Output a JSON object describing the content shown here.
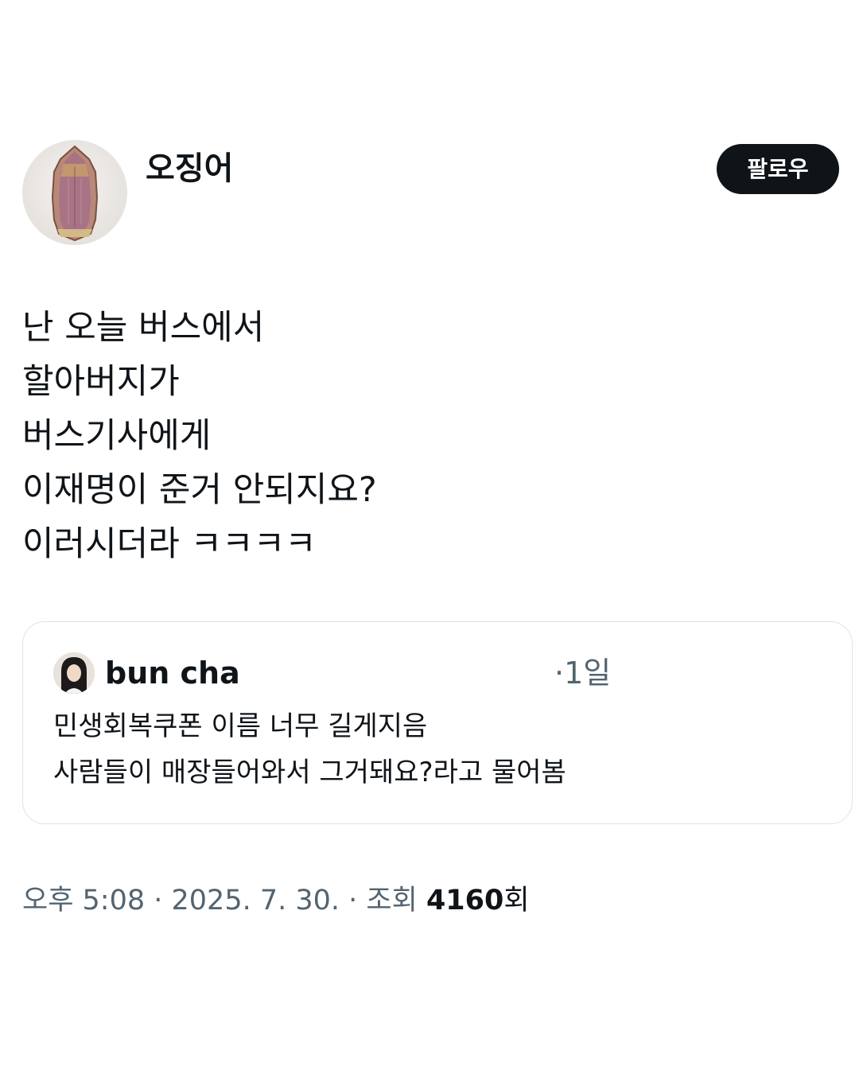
{
  "author": {
    "name": "오징어",
    "handle": ""
  },
  "follow_label": "팔로우",
  "post": {
    "lines": [
      "난 오늘 버스에서",
      "할아버지가",
      "버스기사에게",
      "이재명이 준거 안되지요?",
      "이러시더라 ㅋㅋㅋㅋ"
    ]
  },
  "quote": {
    "name": "bun cha",
    "time": "·1일",
    "lines": [
      "민생회복쿠폰 이름 너무 길게지음",
      "사람들이 매장들어와서 그거돼요?라고 물어봄"
    ]
  },
  "meta": {
    "time": "오후 5:08",
    "sep1": " · ",
    "date": "2025. 7. 30.",
    "sep2": " · ",
    "views_prefix": "조회 ",
    "views_count": "4160",
    "views_suffix": "회"
  },
  "colors": {
    "text": "#0f1419",
    "muted": "#536471",
    "border": "#dfe3e6",
    "button_bg": "#0f1419",
    "button_text": "#ffffff"
  }
}
